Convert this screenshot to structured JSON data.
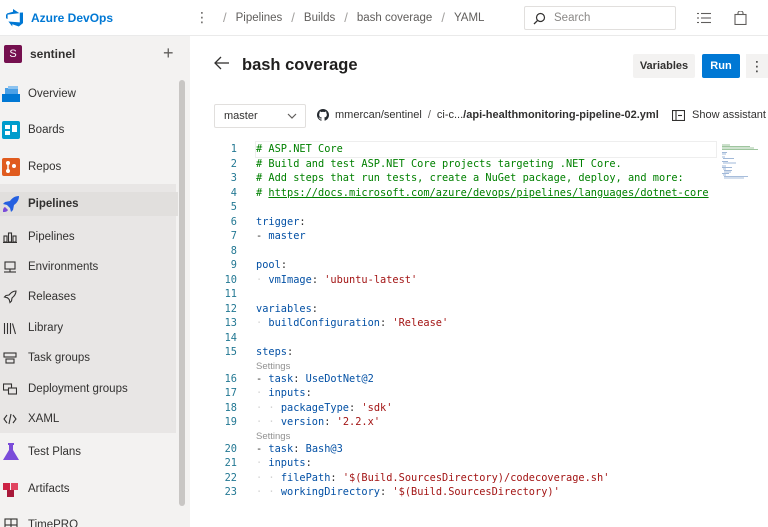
{
  "topbar": {
    "brand": "Azure DevOps",
    "more_icon": "ellipsis-vertical-icon",
    "breadcrumbs": [
      "Pipelines",
      "Builds",
      "bash coverage",
      "YAML"
    ],
    "search_placeholder": "Search"
  },
  "sidebar": {
    "project_initial": "S",
    "project_name": "sentinel",
    "items": [
      {
        "label": "Overview",
        "icon": "overview-icon"
      },
      {
        "label": "Boards",
        "icon": "boards-icon"
      },
      {
        "label": "Repos",
        "icon": "repos-icon"
      },
      {
        "label": "Pipelines",
        "icon": "pipelines-icon"
      },
      {
        "label": "Pipelines",
        "icon": "pipelines-sub-icon"
      },
      {
        "label": "Environments",
        "icon": "environments-icon"
      },
      {
        "label": "Releases",
        "icon": "releases-icon"
      },
      {
        "label": "Library",
        "icon": "library-icon"
      },
      {
        "label": "Task groups",
        "icon": "task-groups-icon"
      },
      {
        "label": "Deployment groups",
        "icon": "deployment-groups-icon"
      },
      {
        "label": "XAML",
        "icon": "xaml-icon"
      },
      {
        "label": "Test Plans",
        "icon": "test-plans-icon"
      },
      {
        "label": "Artifacts",
        "icon": "artifacts-icon"
      },
      {
        "label": "TimePRO",
        "icon": "timepro-icon"
      }
    ]
  },
  "page": {
    "title": "bash coverage",
    "variables_label": "Variables",
    "run_label": "Run",
    "more_label": "⋮"
  },
  "toolbar": {
    "branch": "master",
    "repo": "mmercan/sentinel",
    "path_prefix": "ci-c...",
    "file": "/api-healthmonitoring-pipeline-02.yml",
    "assistant_label": "Show assistant"
  },
  "editor": {
    "codelens": "Settings",
    "lines": [
      {
        "n": "1",
        "text": "# ASP.NET Core"
      },
      {
        "n": "2",
        "text": "# Build and test ASP.NET Core projects targeting .NET Core."
      },
      {
        "n": "3",
        "text": "# Add steps that run tests, create a NuGet package, deploy, and more:"
      },
      {
        "n": "4",
        "text": "# https://docs.microsoft.com/azure/devops/pipelines/languages/dotnet-core"
      },
      {
        "n": "5",
        "text": ""
      },
      {
        "n": "6",
        "text": "trigger:"
      },
      {
        "n": "7",
        "text": "- master"
      },
      {
        "n": "8",
        "text": ""
      },
      {
        "n": "9",
        "text": "pool:"
      },
      {
        "n": "10",
        "text": "  vmImage: 'ubuntu-latest'"
      },
      {
        "n": "11",
        "text": ""
      },
      {
        "n": "12",
        "text": "variables:"
      },
      {
        "n": "13",
        "text": "  buildConfiguration: 'Release'"
      },
      {
        "n": "14",
        "text": ""
      },
      {
        "n": "15",
        "text": "steps:"
      },
      {
        "n": "16",
        "text": "- task: UseDotNet@2"
      },
      {
        "n": "17",
        "text": "  inputs:"
      },
      {
        "n": "18",
        "text": "    packageType: 'sdk'"
      },
      {
        "n": "19",
        "text": "    version: '2.2.x'"
      },
      {
        "n": "20",
        "text": "- task: Bash@3"
      },
      {
        "n": "21",
        "text": "  inputs:"
      },
      {
        "n": "22",
        "text": "    filePath: '$(Build.SourcesDirectory)/codecoverage.sh'"
      },
      {
        "n": "23",
        "text": "    workingDirectory: '$(Build.SourcesDirectory)'"
      }
    ]
  },
  "colors": {
    "accent": "#0078d4",
    "project_badge": "#75104f",
    "comment": "#008000",
    "key": "#0451a5",
    "string": "#a31515"
  }
}
